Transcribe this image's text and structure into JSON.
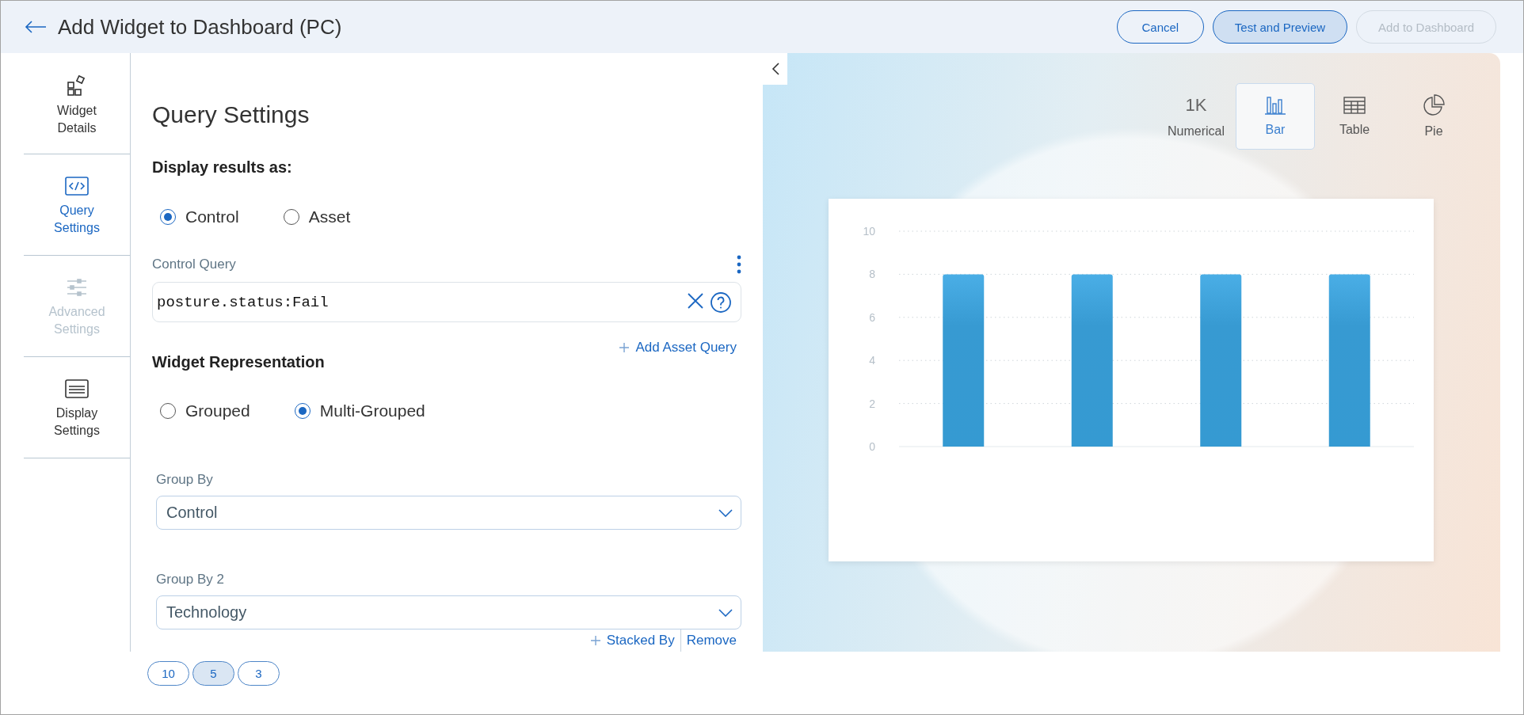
{
  "header": {
    "title": "Add Widget to Dashboard (PC)",
    "buttons": [
      {
        "label": "Cancel",
        "kind": "outline",
        "disabled": false
      },
      {
        "label": "Test and Preview",
        "kind": "filled",
        "disabled": false
      },
      {
        "label": "Add to Dashboard",
        "kind": "outline",
        "disabled": true
      }
    ]
  },
  "sidebar": {
    "items": [
      {
        "label": "Widget Details",
        "kind": "widgets",
        "selected": false,
        "disabled": false
      },
      {
        "label": "Query Settings",
        "kind": "code",
        "selected": true,
        "disabled": false
      },
      {
        "label": "Advanced Settings",
        "kind": "sliders",
        "selected": false,
        "disabled": true
      },
      {
        "label": "Display Settings",
        "kind": "display",
        "selected": false,
        "disabled": false
      }
    ]
  },
  "form": {
    "title": "Query Settings",
    "display_label": "Display results as:",
    "display_options": [
      {
        "label": "Control",
        "selected": true
      },
      {
        "label": "Asset",
        "selected": false
      }
    ],
    "query": {
      "label": "Control Query",
      "value": "posture.status:Fail"
    },
    "add_asset_query": "Add Asset Query",
    "representation_label": "Widget Representation",
    "representation_options": [
      {
        "label": "Grouped",
        "selected": false
      },
      {
        "label": "Multi-Grouped",
        "selected": true
      }
    ],
    "group_by": {
      "label": "Group By",
      "value": "Control"
    },
    "group_by_2": {
      "label": "Group By 2",
      "value": "Technology"
    },
    "stacked_by": "Stacked By",
    "remove": "Remove"
  },
  "pagination": [
    {
      "label": "10",
      "selected": false
    },
    {
      "label": "5",
      "selected": true
    },
    {
      "label": "3",
      "selected": false
    }
  ],
  "preview": {
    "chart_types": [
      {
        "label": "Numerical",
        "kind": "numerical",
        "glyph": "1K",
        "selected": false
      },
      {
        "label": "Bar",
        "kind": "bar",
        "selected": true
      },
      {
        "label": "Table",
        "kind": "table",
        "selected": false
      },
      {
        "label": "Pie",
        "kind": "pie",
        "selected": false
      }
    ],
    "chart_data": {
      "type": "bar",
      "values": [
        8,
        8,
        8,
        8
      ],
      "ylim": [
        0,
        10
      ],
      "grid": true,
      "yticks": [
        0,
        2,
        4,
        6,
        8,
        10
      ]
    }
  }
}
